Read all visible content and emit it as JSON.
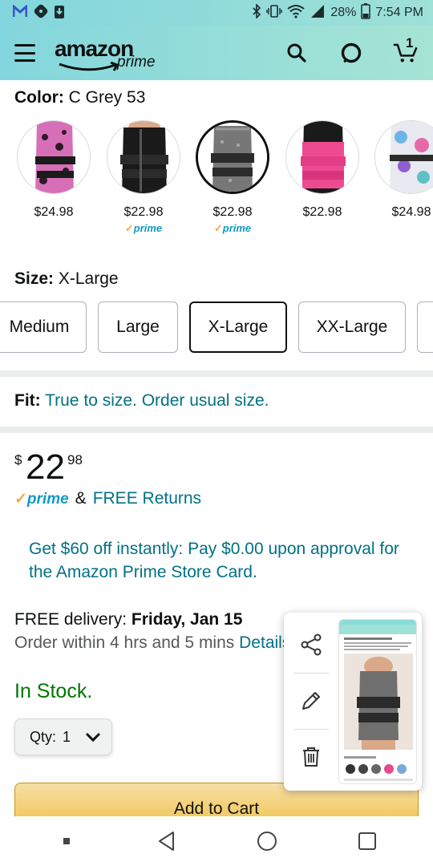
{
  "status_bar": {
    "battery": "28%",
    "time": "7:54 PM"
  },
  "header": {
    "logo_main": "amazon",
    "logo_sub": "prime",
    "cart_count": "1"
  },
  "color": {
    "label": "Color:",
    "value": "C Grey 53",
    "swatches": [
      {
        "price": "$24.98",
        "prime": "",
        "selected": false,
        "desc": "pink leopard"
      },
      {
        "price": "$22.98",
        "prime": "prime",
        "selected": false,
        "desc": "black"
      },
      {
        "price": "$22.98",
        "prime": "prime",
        "selected": true,
        "desc": "grey"
      },
      {
        "price": "$22.98",
        "prime": "",
        "selected": false,
        "desc": "pink"
      },
      {
        "price": "$24.98",
        "prime": "",
        "selected": false,
        "desc": "floral"
      }
    ]
  },
  "size": {
    "label": "Size:",
    "value": "X-Large",
    "options": [
      "Medium",
      "Large",
      "X-Large",
      "XX-Large"
    ]
  },
  "fit": {
    "label": "Fit:",
    "value": "True to size. Order usual size."
  },
  "price": {
    "currency": "$",
    "whole": "22",
    "fraction": "98"
  },
  "prime_row": {
    "prime": "prime",
    "amp": "&",
    "returns": "FREE Returns"
  },
  "promo": "Get $60 off instantly: Pay $0.00 upon approval for the Amazon Prime Store Card.",
  "delivery": {
    "label": "FREE delivery:",
    "date": "Friday, Jan 15",
    "order_within": "Order within 4 hrs and 5 mins",
    "details": "Details"
  },
  "stock": "In Stock.",
  "qty": {
    "label": "Qty:",
    "value": "1"
  },
  "add_to_cart": "Add to Cart",
  "colors": {
    "header_bg": "#8adcd9",
    "link": "#007185",
    "in_stock": "#007600",
    "prime_blue": "#1399c4",
    "cart_yellow": "#f0c14b"
  }
}
